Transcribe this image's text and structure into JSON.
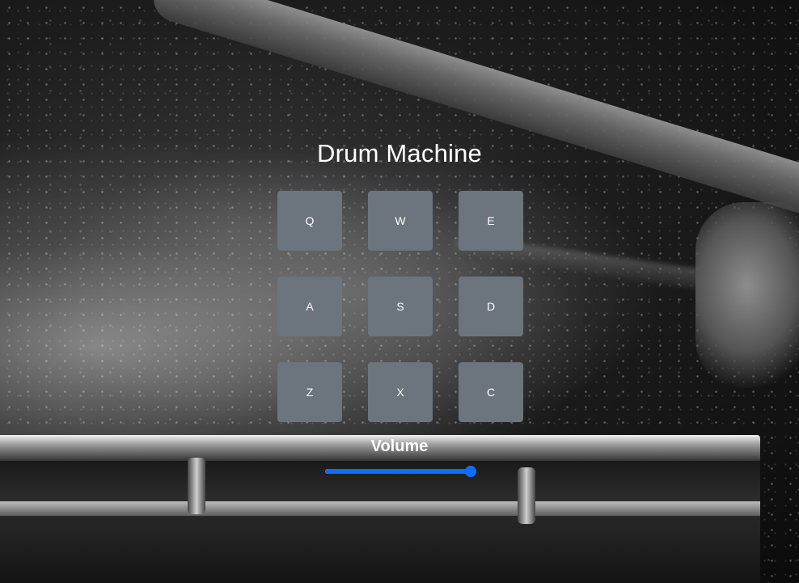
{
  "app": {
    "title": "Drum Machine"
  },
  "pads": [
    {
      "key": "Q"
    },
    {
      "key": "W"
    },
    {
      "key": "E"
    },
    {
      "key": "A"
    },
    {
      "key": "S"
    },
    {
      "key": "D"
    },
    {
      "key": "Z"
    },
    {
      "key": "X"
    },
    {
      "key": "C"
    }
  ],
  "volume": {
    "label": "Volume",
    "level": 1.0
  },
  "colors": {
    "pad_background": "#6c757d",
    "slider_accent": "#0d6efd",
    "text": "#ffffff"
  }
}
